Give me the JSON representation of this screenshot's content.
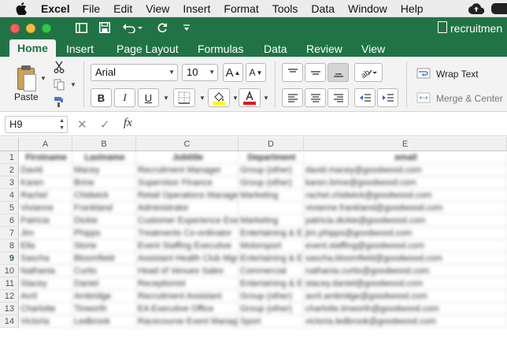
{
  "menubar": {
    "app_name": "Excel",
    "items": [
      "File",
      "Edit",
      "View",
      "Insert",
      "Format",
      "Tools",
      "Data",
      "Window",
      "Help"
    ]
  },
  "window": {
    "title": "recruitmen"
  },
  "ribbon_tabs": [
    "Home",
    "Insert",
    "Page Layout",
    "Formulas",
    "Data",
    "Review",
    "View"
  ],
  "ribbon": {
    "paste_label": "Paste",
    "font_name": "Arial",
    "font_size": "10",
    "bold": "B",
    "italic": "I",
    "underline": "U",
    "grow_font": "A",
    "shrink_font": "A",
    "wrap_text": "Wrap Text",
    "merge_center": "Merge & Center"
  },
  "formula_bar": {
    "name_box": "H9",
    "fx": "fx",
    "formula": ""
  },
  "colors": {
    "excel_green": "#217346",
    "selected_row_header": "#217346"
  },
  "grid": {
    "columns": [
      "A",
      "B",
      "C",
      "D",
      "E"
    ],
    "rows": [
      "1",
      "2",
      "3",
      "4",
      "5",
      "6",
      "7",
      "8",
      "9",
      "10",
      "11",
      "12",
      "13",
      "14"
    ],
    "selected_row": "9",
    "cells": [
      [
        "Firstname",
        "Lastname",
        "Jobtitle",
        "Department",
        "email"
      ],
      [
        "David",
        "Macey",
        "Recruitment Manager",
        "Group (other)",
        "david.macey@goodwood.com"
      ],
      [
        "Karen",
        "Brine",
        "Supervisor Finance",
        "Group (other)",
        "karen.brine@goodwood.com"
      ],
      [
        "Rachel",
        "Chidwick",
        "Retail Operations Manager",
        "Marketing",
        "rachel.chidwick@goodwood.com"
      ],
      [
        "Vivianne",
        "Frankland",
        "Administrator",
        "",
        "vivianne.frankland@goodwood.com"
      ],
      [
        "Patricia",
        "Dickie",
        "Customer Experience Exec",
        "Marketing",
        "patricia.dickie@goodwood.com"
      ],
      [
        "Jim",
        "Phipps",
        "Treatments Co-ordinator",
        "Entertaining & E",
        "jim.phipps@goodwood.com"
      ],
      [
        "Ella",
        "Storie",
        "Event Staffing Executive",
        "Motorsport",
        "event.staffing@goodwood.com"
      ],
      [
        "Sascha",
        "Bloomfield",
        "Assistant Health Club Mgr",
        "Entertaining & E",
        "sascha.bloomfield@goodwood.com"
      ],
      [
        "Nathania",
        "Curtis",
        "Head of Venues Sales",
        "Commercial",
        "nathania.curtis@goodwood.com"
      ],
      [
        "Stacey",
        "Daniel",
        "Receptionist",
        "Entertaining & E",
        "stacey.daniel@goodwood.com"
      ],
      [
        "Avril",
        "Ambridge",
        "Recruitment Assistant",
        "Group (other)",
        "avril.ambridge@goodwood.com"
      ],
      [
        "Charlotte",
        "Tinworth",
        "EA Executive Office",
        "Group (other)",
        "charlotte.tinworth@goodwood.com"
      ],
      [
        "Victoria",
        "Ledbrook",
        "Racecourse Event Manager",
        "Sport",
        "victoria.ledbrook@goodwood.com"
      ]
    ]
  }
}
